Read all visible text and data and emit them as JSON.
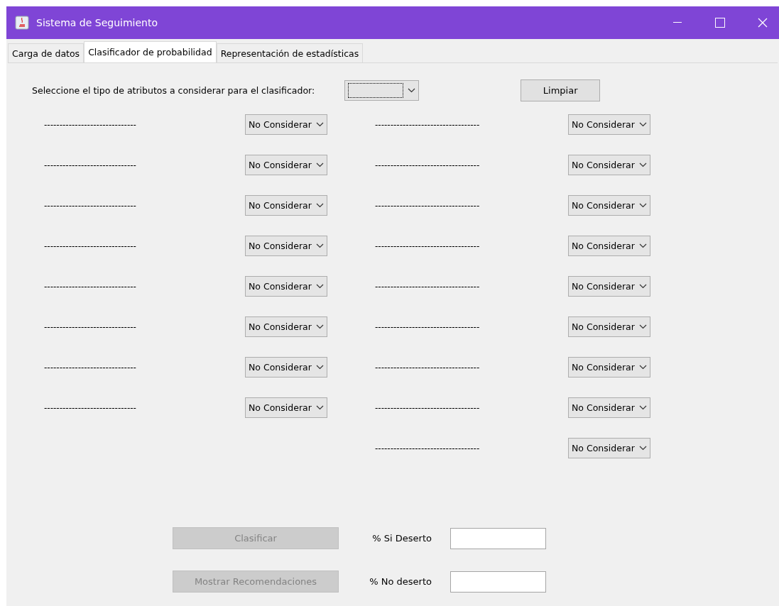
{
  "window": {
    "title": "Sistema de Seguimiento"
  },
  "tabs": [
    {
      "label": "Carga de datos",
      "selected": false
    },
    {
      "label": "Clasificador de probabilidad",
      "selected": true
    },
    {
      "label": "Representación de estadísticas",
      "selected": false
    }
  ],
  "attribute_type": {
    "label": "Seleccione el tipo de atributos a considerar para el clasificador:",
    "focused": true
  },
  "clear_button": {
    "label": "Limpiar",
    "disabled": false
  },
  "left_attributes": [
    {
      "label": "------------------------------",
      "value": "No Considerar"
    },
    {
      "label": "------------------------------",
      "value": "No Considerar"
    },
    {
      "label": "------------------------------",
      "value": "No Considerar"
    },
    {
      "label": "------------------------------",
      "value": "No Considerar"
    },
    {
      "label": "------------------------------",
      "value": "No Considerar"
    },
    {
      "label": "------------------------------",
      "value": "No Considerar"
    },
    {
      "label": "------------------------------",
      "value": "No Considerar"
    },
    {
      "label": "------------------------------",
      "value": "No Considerar"
    }
  ],
  "right_attributes": [
    {
      "label": "----------------------------------",
      "value": "No Considerar"
    },
    {
      "label": "----------------------------------",
      "value": "No Considerar"
    },
    {
      "label": "----------------------------------",
      "value": "No Considerar"
    },
    {
      "label": "----------------------------------",
      "value": "No Considerar"
    },
    {
      "label": "----------------------------------",
      "value": "No Considerar"
    },
    {
      "label": "----------------------------------",
      "value": "No Considerar"
    },
    {
      "label": "----------------------------------",
      "value": "No Considerar"
    },
    {
      "label": "----------------------------------",
      "value": "No Considerar"
    },
    {
      "label": "----------------------------------",
      "value": "No Considerar"
    }
  ],
  "results": [
    {
      "button": "Clasificar",
      "disabled": true,
      "label": "% Si Deserto"
    },
    {
      "button": "Mostrar Recomendaciones",
      "disabled": true,
      "label": "% No deserto"
    }
  ]
}
